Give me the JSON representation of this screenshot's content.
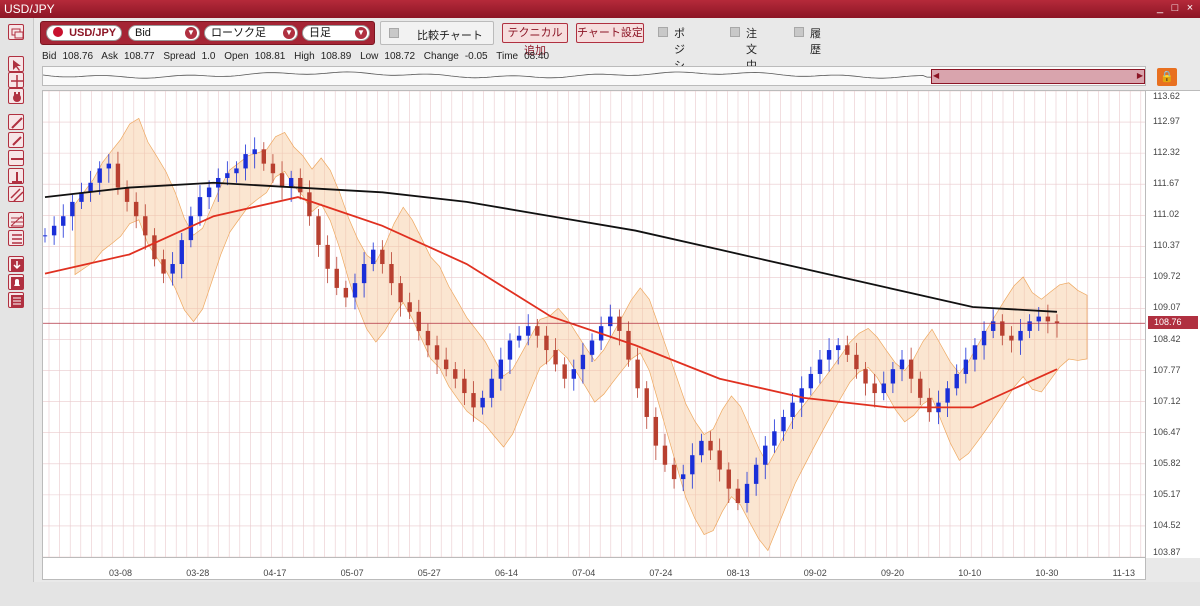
{
  "window": {
    "title": "USD/JPY",
    "minimize": "_",
    "maximize": "□",
    "close": "×"
  },
  "toolbar": {
    "symbol": "USD/JPY",
    "price_type": "Bid",
    "chart_type": "ローソク足",
    "period": "日足",
    "compare_label": "比較チャート",
    "add_technical": "テクニカル追加",
    "chart_settings": "チャート設定",
    "chk_position": "ポジション",
    "chk_orders": "注文中",
    "chk_history": "履歴"
  },
  "info": {
    "bid_label": "Bid",
    "bid": "108.76",
    "ask_label": "Ask",
    "ask": "108.77",
    "spread_label": "Spread",
    "spread": "1.0",
    "open_label": "Open",
    "open": "108.81",
    "high_label": "High",
    "high": "108.89",
    "low_label": "Low",
    "low": "108.72",
    "change_label": "Change",
    "change": "-0.05",
    "time_label": "Time",
    "time": "08:40"
  },
  "icons": [
    "cursor-icon",
    "crosshair-icon",
    "hand-icon",
    "trendline-icon",
    "line-icon",
    "horizontal-line-icon",
    "vertical-line-icon",
    "channel-icon",
    "fibonacci-icon",
    "text-icon",
    "down-arrow-icon",
    "bell-icon",
    "calculator-icon",
    "lock-scroll-icon"
  ],
  "colors": {
    "brand": "#a52535",
    "up": "#1a2fd8",
    "down": "#b84030",
    "ma_short": "#e03020",
    "ma_long": "#111111",
    "cloud": "#f6c89a",
    "current_price": "#b03040"
  },
  "chart_data": {
    "type": "candlestick",
    "current_price": 108.76,
    "y_ticks": [
      "113.62",
      "112.97",
      "112.32",
      "111.67",
      "111.02",
      "110.37",
      "109.72",
      "109.07",
      "108.42",
      "107.77",
      "107.12",
      "106.47",
      "105.82",
      "105.17",
      "104.52",
      "103.87"
    ],
    "ylim": [
      103.87,
      113.62
    ],
    "x_ticks": [
      "03-08",
      "03-28",
      "04-17",
      "05-07",
      "05-27",
      "06-14",
      "07-04",
      "07-24",
      "08-13",
      "09-02",
      "09-20",
      "10-10",
      "10-30",
      "11-13"
    ],
    "series_ma_long": [
      111.4,
      111.6,
      111.7,
      111.6,
      111.5,
      111.3,
      111.0,
      110.7,
      110.3,
      109.9,
      109.5,
      109.1,
      109.0
    ],
    "series_ma_short": [
      109.8,
      110.2,
      111.0,
      111.4,
      110.8,
      110.0,
      108.9,
      108.3,
      107.6,
      107.2,
      107.0,
      107.0,
      107.8
    ],
    "candles": [
      110.6,
      110.8,
      111.0,
      111.3,
      111.5,
      111.7,
      112.0,
      112.1,
      111.6,
      111.3,
      111.0,
      110.6,
      110.1,
      109.8,
      110.0,
      110.5,
      111.0,
      111.4,
      111.6,
      111.8,
      111.9,
      112.0,
      112.3,
      112.4,
      112.1,
      111.9,
      111.6,
      111.8,
      111.5,
      111.0,
      110.4,
      109.9,
      109.5,
      109.3,
      109.6,
      110.0,
      110.3,
      110.0,
      109.6,
      109.2,
      109.0,
      108.6,
      108.3,
      108.0,
      107.8,
      107.6,
      107.3,
      107.0,
      107.2,
      107.6,
      108.0,
      108.4,
      108.5,
      108.7,
      108.5,
      108.2,
      107.9,
      107.6,
      107.8,
      108.1,
      108.4,
      108.7,
      108.9,
      108.6,
      108.0,
      107.4,
      106.8,
      106.2,
      105.8,
      105.5,
      105.6,
      106.0,
      106.3,
      106.1,
      105.7,
      105.3,
      105.0,
      105.4,
      105.8,
      106.2,
      106.5,
      106.8,
      107.1,
      107.4,
      107.7,
      108.0,
      108.2,
      108.3,
      108.1,
      107.8,
      107.5,
      107.3,
      107.5,
      107.8,
      108.0,
      107.6,
      107.2,
      106.9,
      107.1,
      107.4,
      107.7,
      108.0,
      108.3,
      108.6,
      108.8,
      108.5,
      108.4,
      108.6,
      108.8,
      108.9,
      108.8,
      108.76
    ]
  }
}
